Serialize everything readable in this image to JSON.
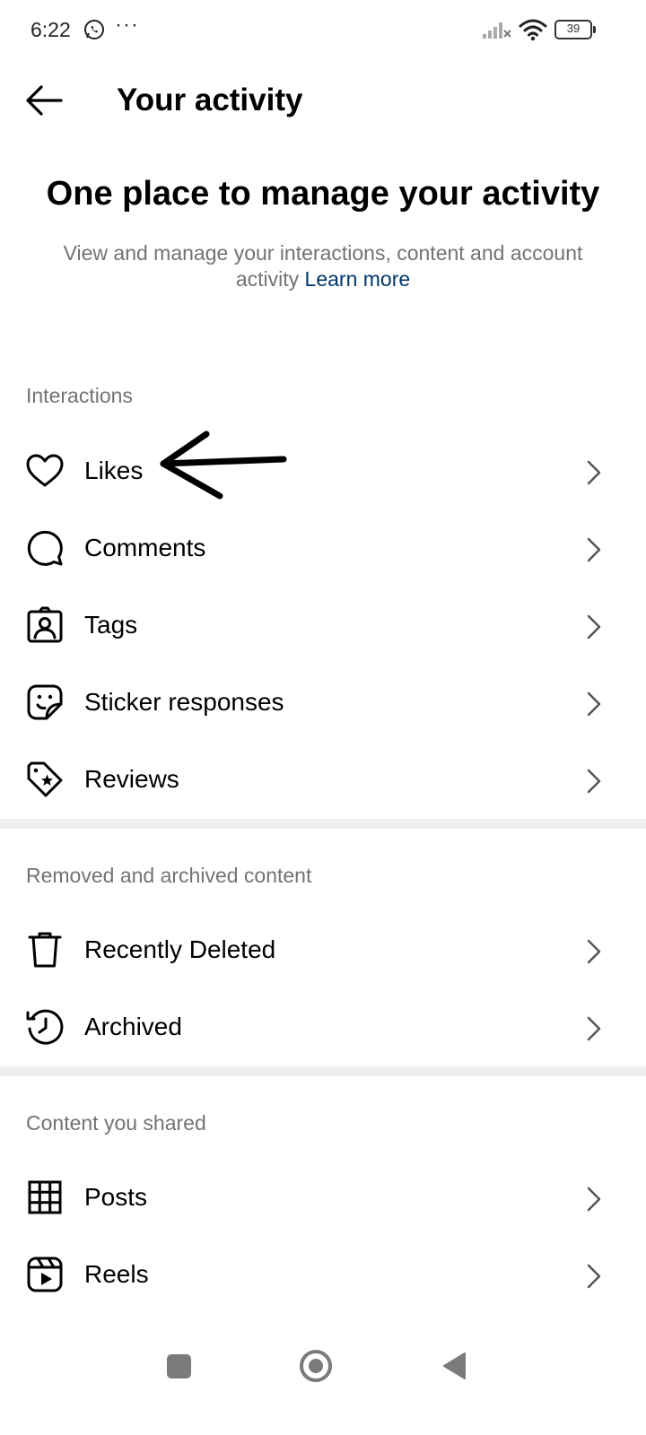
{
  "status_bar": {
    "time": "6:22",
    "more": "···",
    "battery": "39",
    "icons": [
      "whatsapp-icon",
      "signal-icon",
      "wifi-icon",
      "battery-icon"
    ]
  },
  "header": {
    "title": "Your activity",
    "back_icon": "arrow-left-icon"
  },
  "intro": {
    "heading": "One place to manage your activity",
    "description": "View and manage your interactions, content and account activity",
    "link": "Learn more",
    "link_color": "#00376b"
  },
  "sections": [
    {
      "title": "Interactions",
      "items": [
        {
          "label": "Likes",
          "icon": "heart-icon"
        },
        {
          "label": "Comments",
          "icon": "comment-icon"
        },
        {
          "label": "Tags",
          "icon": "tag-person-icon"
        },
        {
          "label": "Sticker responses",
          "icon": "sticker-icon"
        },
        {
          "label": "Reviews",
          "icon": "review-tag-icon"
        }
      ]
    },
    {
      "title": "Removed and archived content",
      "items": [
        {
          "label": "Recently Deleted",
          "icon": "trash-icon"
        },
        {
          "label": "Archived",
          "icon": "archive-history-icon"
        }
      ]
    },
    {
      "title": "Content you shared",
      "items": [
        {
          "label": "Posts",
          "icon": "grid-icon"
        },
        {
          "label": "Reels",
          "icon": "reels-icon"
        }
      ]
    }
  ],
  "colors": {
    "text_primary": "#000000",
    "text_secondary": "#737373",
    "divider": "#efefef",
    "link": "#00376b"
  },
  "navigation_bar": {
    "icons": [
      "recents-icon",
      "home-icon",
      "back-triangle-icon"
    ]
  }
}
